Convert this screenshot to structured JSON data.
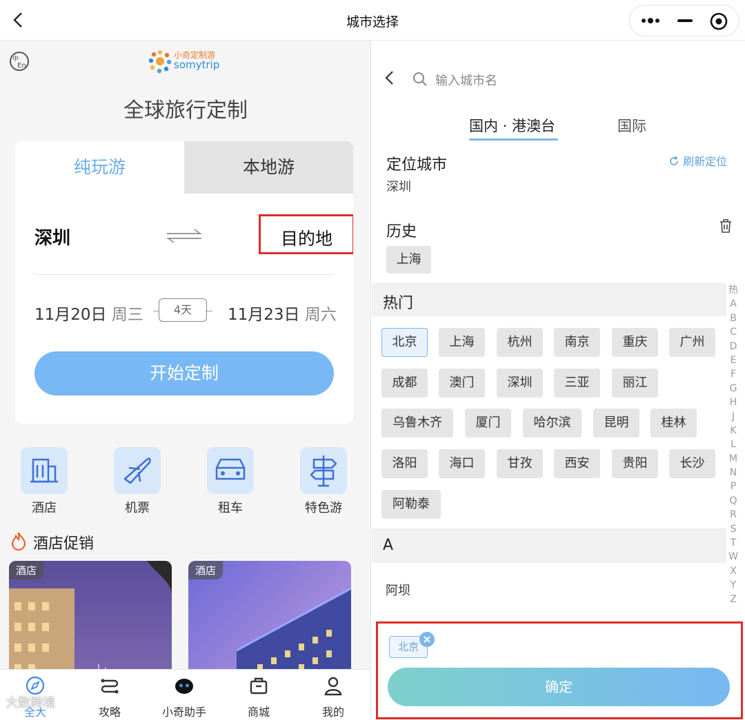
{
  "window": {
    "title": "城市选择"
  },
  "left": {
    "logo_cn": "小奇定制游",
    "logo_en": "somytrip",
    "headline": "全球旅行定制",
    "tabs": [
      "纯玩游",
      "本地游"
    ],
    "from_city": "深圳",
    "destination": "目的地",
    "start_date": "11月20日",
    "start_weekday": "周三",
    "duration": "4天",
    "end_date": "11月23日",
    "end_weekday": "周六",
    "start_button": "开始定制",
    "services": [
      "酒店",
      "机票",
      "租车",
      "特色游"
    ],
    "promo_title": "酒店促销",
    "hotel_tags": [
      "酒店",
      "酒店"
    ],
    "tabbar": [
      "全大",
      "攻略",
      "小奇助手",
      "商城",
      "我的"
    ],
    "watermark": "大数跨境"
  },
  "right": {
    "search_placeholder": "输入城市名",
    "tabs": [
      "国内 · 港澳台",
      "国际"
    ],
    "located_title": "定位城市",
    "located_city": "深圳",
    "refresh": "刷新定位",
    "history_title": "历史",
    "history": [
      "上海"
    ],
    "hot_title": "热门",
    "hot_cities": [
      [
        "北京",
        "上海",
        "杭州",
        "南京",
        "重庆",
        "广州"
      ],
      [
        "成都",
        "澳门",
        "深圳",
        "三亚",
        "丽江"
      ],
      [
        "乌鲁木齐",
        "厦门",
        "哈尔滨",
        "昆明",
        "桂林"
      ],
      [
        "洛阳",
        "海口",
        "甘孜",
        "西安",
        "贵阳",
        "长沙"
      ],
      [
        "阿勒泰"
      ]
    ],
    "section_a": "A",
    "a_cities": [
      "阿坝"
    ],
    "index": [
      "热",
      "A",
      "B",
      "C",
      "D",
      "E",
      "F",
      "G",
      "H",
      "J",
      "K",
      "L",
      "M",
      "N",
      "P",
      "Q",
      "R",
      "S",
      "T",
      "W",
      "X",
      "Y",
      "Z"
    ],
    "selected": [
      "北京"
    ],
    "confirm": "确定"
  },
  "colors": {
    "accent": "#77b8f5",
    "highlight_border": "#e02a2a",
    "selected_chip": "#7cb5ec"
  }
}
